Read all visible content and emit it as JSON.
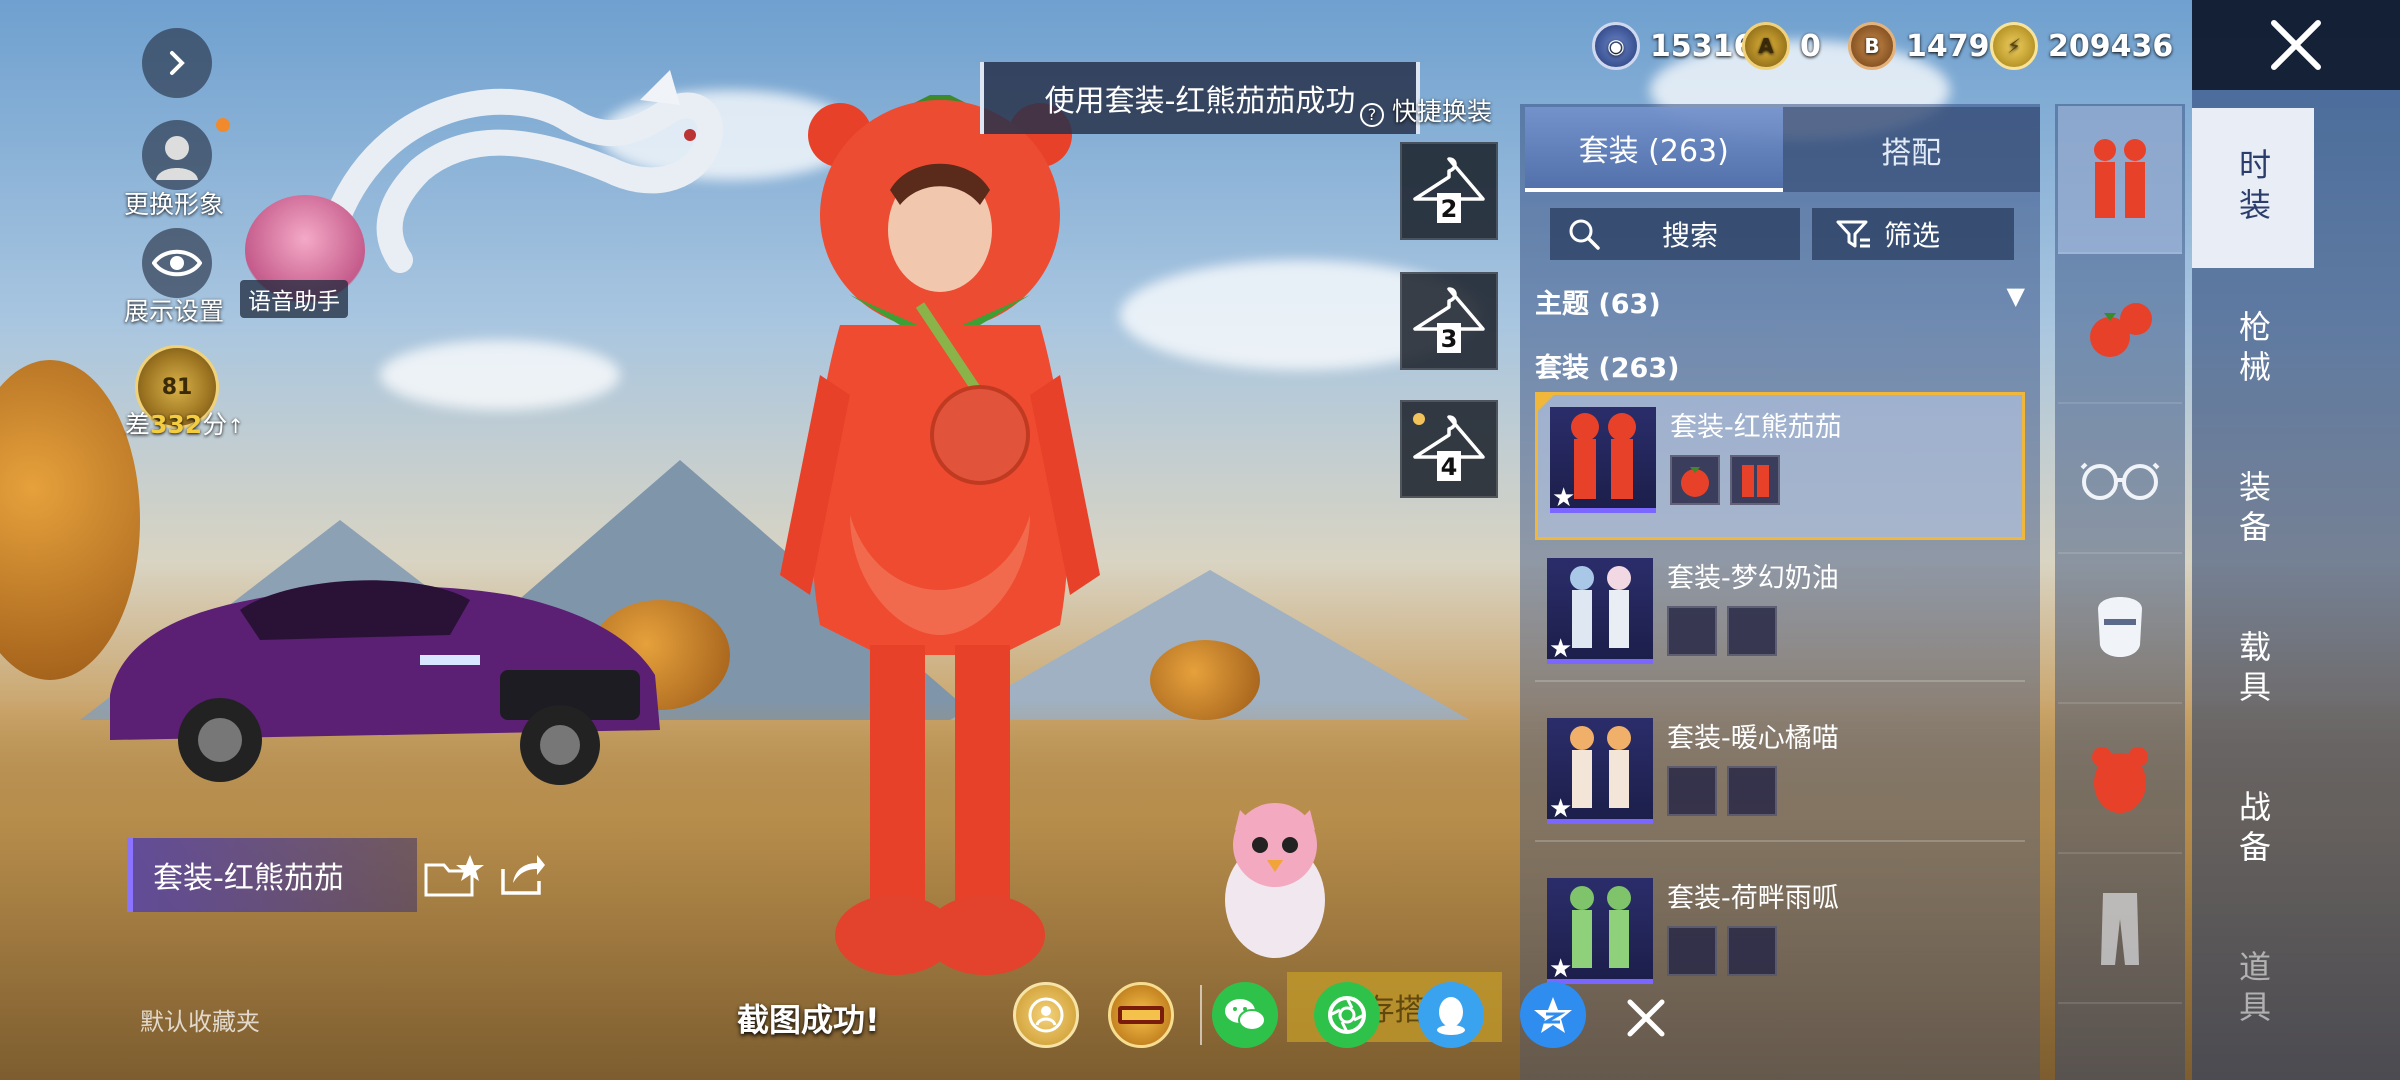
{
  "left_menu": {
    "change_avatar_label": "更换形象",
    "display_settings_label": "展示设置",
    "voice_assistant_label": "语音助手",
    "rank_level": "81",
    "rank_gap_prefix": "差",
    "rank_gap_points": "332",
    "rank_gap_suffix": "分"
  },
  "toast": {
    "message": "使用套装-红熊茄茄成功"
  },
  "quick_outfit": {
    "title": "快捷换装",
    "slots": [
      "2",
      "3",
      "4"
    ]
  },
  "currencies": [
    {
      "icon": "uc-coin-icon",
      "value": "15316"
    },
    {
      "icon": "ag-coin-icon",
      "value": "0"
    },
    {
      "icon": "bp-coin-icon",
      "value": "1479"
    },
    {
      "icon": "energy-coin-icon",
      "value": "209436"
    }
  ],
  "outfit_bar": {
    "name": "套装-红熊茄茄",
    "favorite_folder": "默认收藏夹"
  },
  "panel": {
    "tab_outfits": "套装 (263)",
    "tab_match": "搭配",
    "search_label": "搜索",
    "filter_label": "筛选",
    "theme_label": "主题 (63)",
    "section_label": "套装 (263)",
    "items": [
      {
        "title": "套装-红熊茄茄"
      },
      {
        "title": "套装-梦幻奶油"
      },
      {
        "title": "套装-暖心橘喵"
      },
      {
        "title": "套装-荷畔雨呱"
      }
    ]
  },
  "vertical_nav": [
    "时装",
    "枪械",
    "装备",
    "载具",
    "战备",
    "道具"
  ],
  "share_bar": {
    "screenshot_message": "截图成功!",
    "save_label": "存搭"
  },
  "colors": {
    "accent_gold": "#f0b73a",
    "selected_border": "#f0b73a",
    "rank_points": "#f3cc3f"
  }
}
